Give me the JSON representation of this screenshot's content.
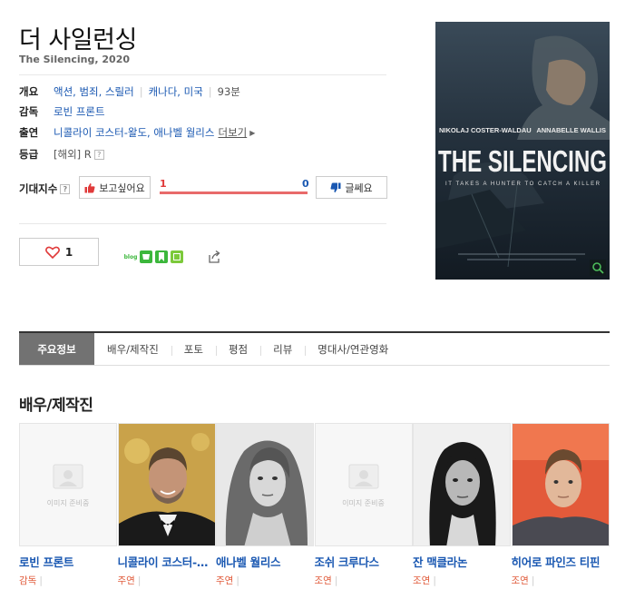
{
  "movie": {
    "title": "더 사일런싱",
    "subtitle": "The Silencing, 2020"
  },
  "info": {
    "overview_label": "개요",
    "genres": "액션, 범죄, 스릴러",
    "countries": "캐나다, 미국",
    "runtime": "93분",
    "director_label": "감독",
    "director": "로빈 프론트",
    "cast_label": "출연",
    "cast": "니콜라이 코스터-왈도, 애나벨 월리스",
    "more": "더보기",
    "rating_label": "등급",
    "rating": "[해외] R",
    "rating_help": "?"
  },
  "expectation": {
    "label": "기대지수",
    "help": "?",
    "want_label": "보고싶어요",
    "dislike_label": "글쎄요",
    "want_count": "1",
    "dislike_count": "0",
    "want_ratio": 1.0
  },
  "like": {
    "count": "1"
  },
  "share": {
    "icons": [
      "blog-share-icon",
      "cafe-share-icon",
      "bookmark-share-icon",
      "memo-share-icon",
      "share-out-icon"
    ],
    "blog_text": "blog"
  },
  "poster": {
    "actor_left": "NIKOLAJ COSTER-WALDAU",
    "actor_right": "ANNABELLE WALLIS",
    "title": "THE SILENCING",
    "tagline": "IT TAKES A HUNTER TO CATCH A KILLER"
  },
  "tabs": [
    {
      "label": "주요정보",
      "active": true
    },
    {
      "label": "배우/제작진",
      "active": false
    },
    {
      "label": "포토",
      "active": false
    },
    {
      "label": "평점",
      "active": false
    },
    {
      "label": "리뷰",
      "active": false
    },
    {
      "label": "명대사/연관영화",
      "active": false
    }
  ],
  "cast_section": {
    "title": "배우/제작진",
    "no_image_text": "이미지 준비중",
    "members": [
      {
        "name": "로빈 프론트",
        "role": "감독",
        "has_photo": false
      },
      {
        "name": "니콜라이 코스터-왈도",
        "role": "주연",
        "has_photo": true
      },
      {
        "name": "애나벨 월리스",
        "role": "주연",
        "has_photo": true
      },
      {
        "name": "조쉬 크루다스",
        "role": "조연",
        "has_photo": false
      },
      {
        "name": "잔 맥클라논",
        "role": "조연",
        "has_photo": true
      },
      {
        "name": "히어로 파인즈 티핀",
        "role": "조연",
        "has_photo": true
      }
    ]
  },
  "colors": {
    "link": "#1a58b2",
    "accent_red": "#e03a3a",
    "gauge": "#e86a6a",
    "tab_active": "#727272",
    "share_green": "#3cb73c"
  }
}
